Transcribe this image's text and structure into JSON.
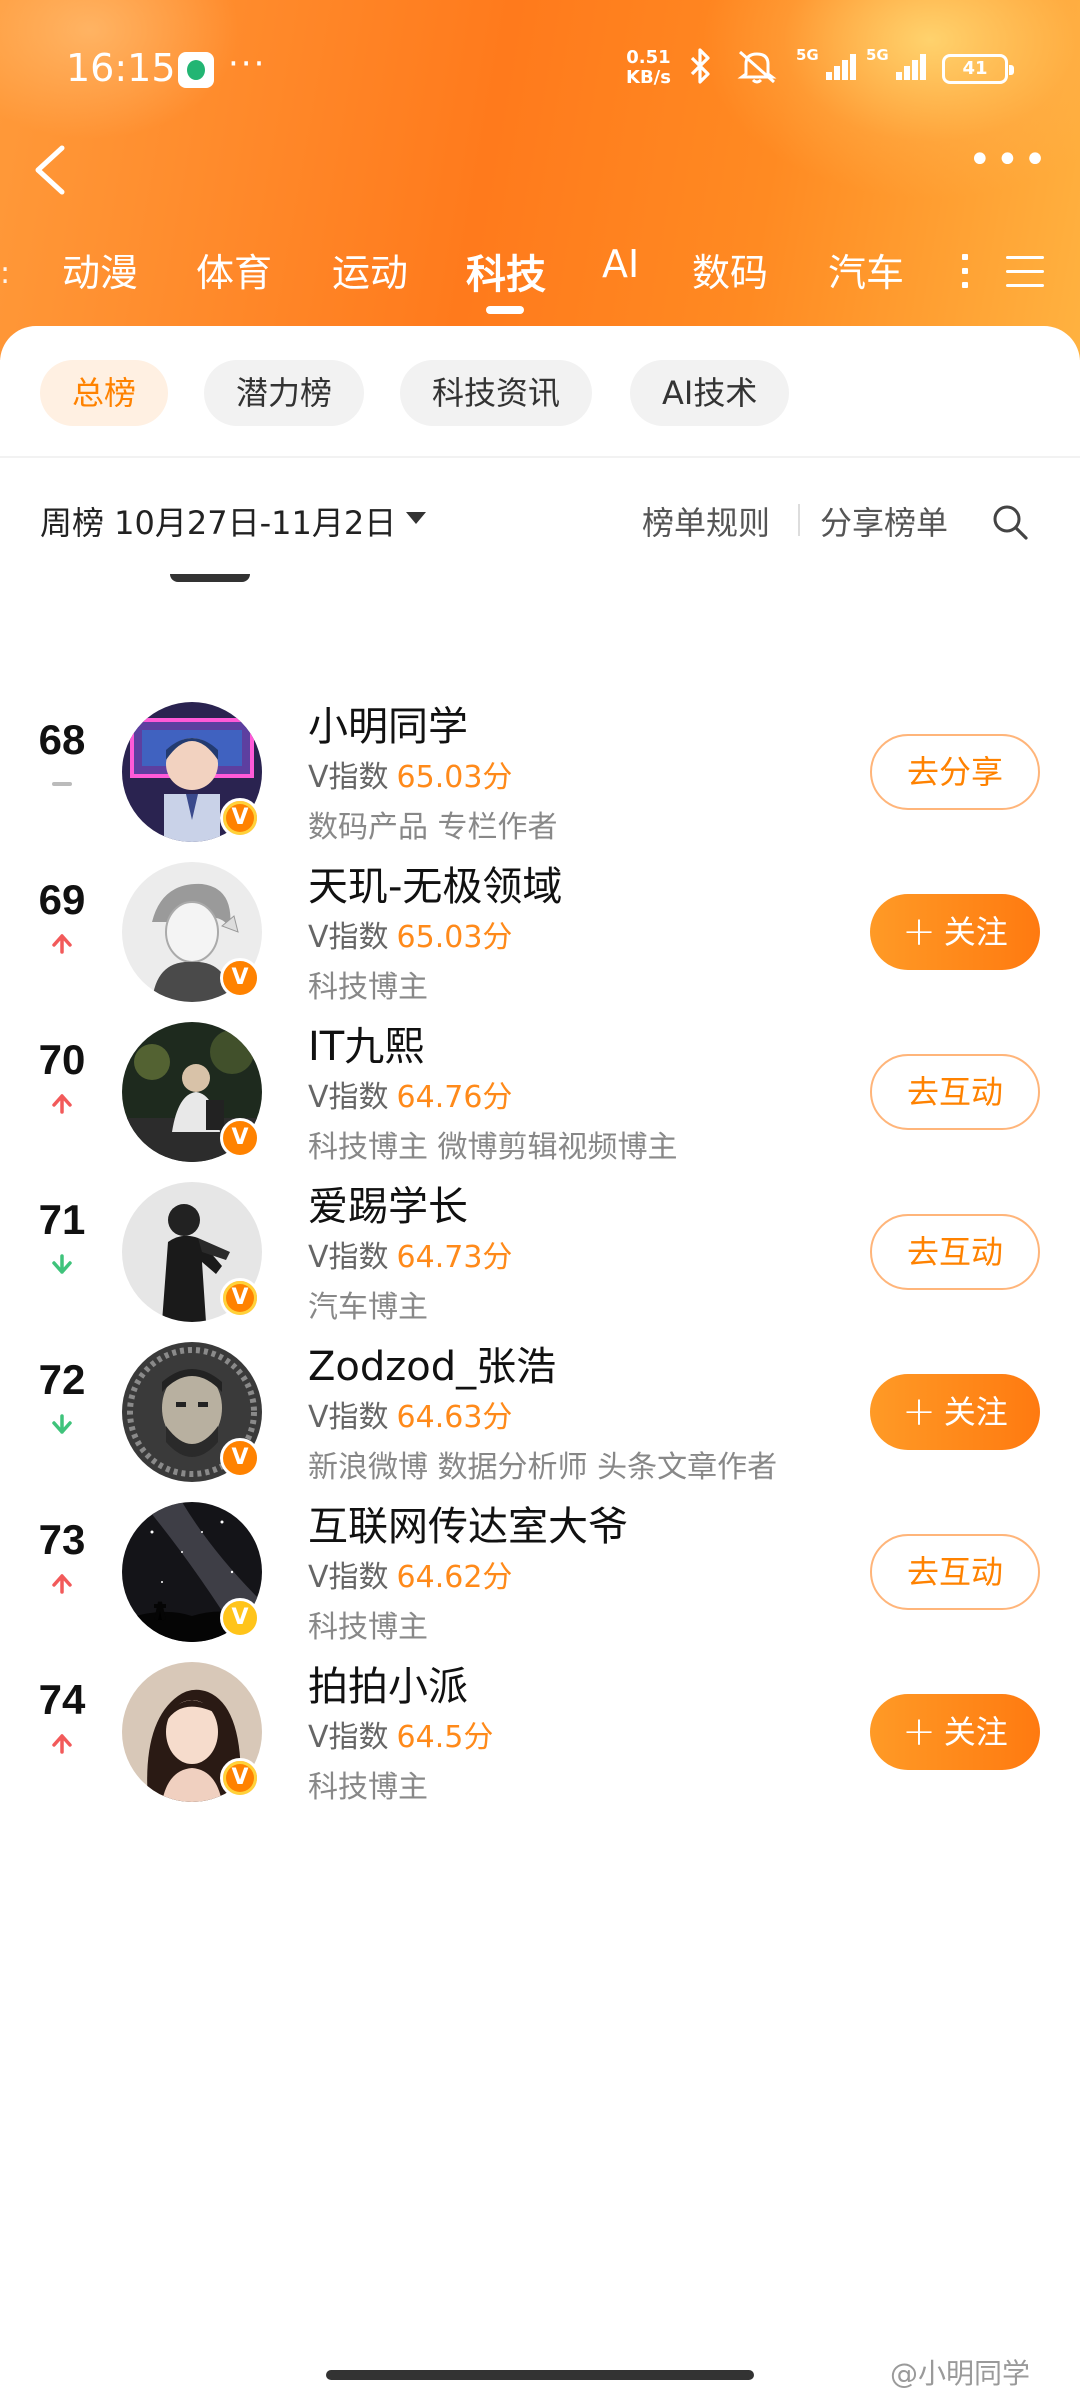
{
  "status_bar": {
    "time": "16:15",
    "net_speed_value": "0.51",
    "net_speed_unit": "KB/s",
    "signal1": "5G",
    "signal2": "5G",
    "battery": "41"
  },
  "category_tabs": [
    "动漫",
    "体育",
    "运动",
    "科技",
    "AI",
    "数码",
    "汽车"
  ],
  "active_category": "科技",
  "sub_tabs": [
    "总榜",
    "潜力榜",
    "科技资讯",
    "AI技术"
  ],
  "active_sub_tab": "总榜",
  "filter": {
    "week_label": "周榜 10月27日-11月2日",
    "rules_label": "榜单规则",
    "share_label": "分享榜单"
  },
  "list": [
    {
      "rank": "68",
      "trend": "same",
      "name": "小明同学",
      "vindex_label": "V指数",
      "score": "65.03分",
      "tags": "数码产品 专栏作者",
      "button": "去分享",
      "button_style": "outline",
      "badge": "red-in"
    },
    {
      "rank": "69",
      "trend": "up",
      "name": "天玑-无极领域",
      "vindex_label": "V指数",
      "score": "65.03分",
      "tags": "科技博主",
      "button": "关注",
      "button_style": "filled",
      "badge": "orange"
    },
    {
      "rank": "70",
      "trend": "up",
      "name": "IT九熙",
      "vindex_label": "V指数",
      "score": "64.76分",
      "tags": "科技博主 微博剪辑视频博主",
      "button": "去互动",
      "button_style": "outline",
      "badge": "orange"
    },
    {
      "rank": "71",
      "trend": "down",
      "name": "爱踢学长",
      "vindex_label": "V指数",
      "score": "64.73分",
      "tags": "汽车博主",
      "button": "去互动",
      "button_style": "outline",
      "badge": "red-in"
    },
    {
      "rank": "72",
      "trend": "down",
      "name": "Zodzod_张浩",
      "vindex_label": "V指数",
      "score": "64.63分",
      "tags": "新浪微博 数据分析师 头条文章作者",
      "button": "关注",
      "button_style": "filled",
      "badge": "orange"
    },
    {
      "rank": "73",
      "trend": "up",
      "name": "互联网传达室大爷",
      "vindex_label": "V指数",
      "score": "64.62分",
      "tags": "科技博主",
      "button": "去互动",
      "button_style": "outline",
      "badge": "gold"
    },
    {
      "rank": "74",
      "trend": "up",
      "name": "拍拍小派",
      "vindex_label": "V指数",
      "score": "64.5分",
      "tags": "科技博主",
      "button": "关注",
      "button_style": "filled",
      "badge": "red-in"
    }
  ],
  "watermark": "@小明同学",
  "colors": {
    "accent": "#ff8200",
    "trend_up": "#f25a5a",
    "trend_down": "#3fc37b",
    "trend_same": "#bbbbbb"
  }
}
